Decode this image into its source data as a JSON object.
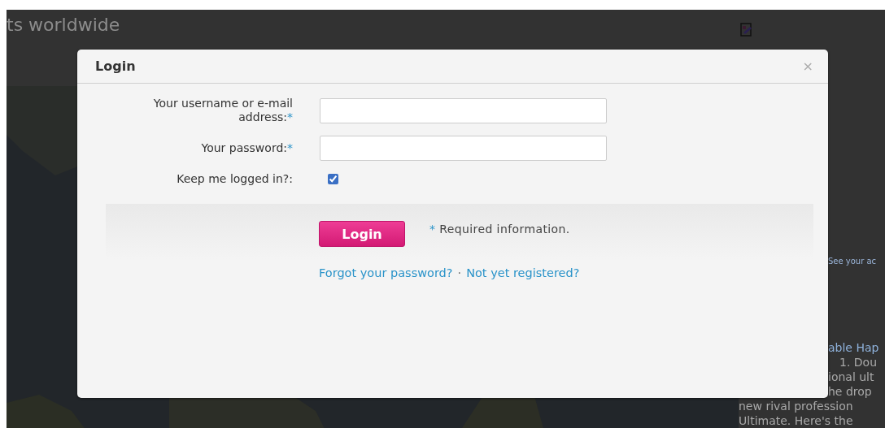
{
  "page": {
    "heading": "ts worldwide",
    "side_note": "See your ac",
    "article_lines": [
      {
        "text": "able Hap",
        "kind": "title"
      },
      {
        "text": "1. Dou",
        "kind": "body"
      },
      {
        "text": "ional ult",
        "kind": "body"
      },
      {
        "text": "he drop",
        "kind": "body"
      },
      {
        "text": "new rival profession",
        "kind": "body"
      },
      {
        "text": "Ultimate. Here's the",
        "kind": "body"
      }
    ]
  },
  "dialog": {
    "title": "Login",
    "close": "×",
    "fields": [
      {
        "kind": "text",
        "label": "Your username or e-mail address:",
        "required_mark": "*"
      },
      {
        "kind": "password",
        "label": "Your password:",
        "required_mark": "*"
      },
      {
        "kind": "checkbox",
        "label": "Keep me logged in?:",
        "checked": true
      }
    ],
    "submit": "Login",
    "note_mark": "*",
    "note": "Required information.",
    "links": [
      "Forgot your password?",
      "Not yet registered?"
    ],
    "link_separator": "·"
  }
}
